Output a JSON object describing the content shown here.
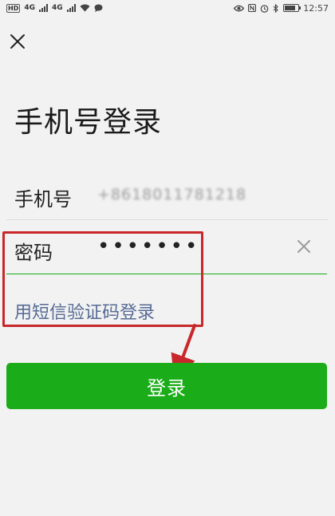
{
  "status_bar": {
    "hd_badge": "HD",
    "network_1": "4G",
    "network_2": "4G",
    "time": "12:57"
  },
  "header": {
    "title": "手机号登录"
  },
  "phone_field": {
    "label": "手机号",
    "value": "+8618011781218"
  },
  "password_field": {
    "label": "密码",
    "value": "•••••••"
  },
  "sms_login_link": "用短信验证码登录",
  "login_button": {
    "label": "登录",
    "color": "#1aad19"
  },
  "colors": {
    "accent": "#1aad19",
    "link": "#576b95",
    "annotation": "#c8282b"
  }
}
